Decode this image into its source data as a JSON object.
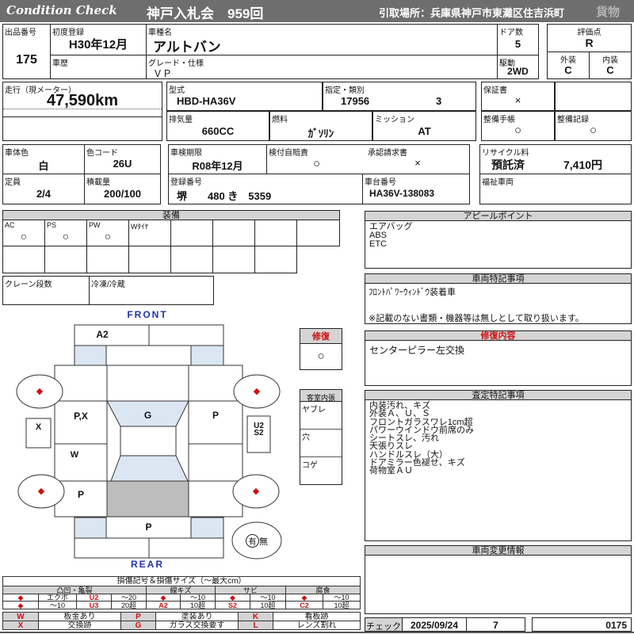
{
  "colors": {
    "accent_red": "#cc1111",
    "top_bar": "#6e6e6e",
    "section_bar": "#d4d4d4",
    "glass_blue": "#dbe6f2",
    "cargo_gray": "#bdbdbd",
    "label_blue": "#2233aa"
  },
  "header": {
    "brand": "Condition Check",
    "auction": "神戸入札会　959回",
    "pickup": "引取場所：兵庫県神戸市東灘区住吉浜町",
    "cargo": "貨物"
  },
  "info": {
    "lot_label": "出品番号",
    "lot": "175",
    "first_reg_label": "初度登録",
    "first_reg": "H30年12月",
    "history_label": "車歴",
    "history": "",
    "model_name_label": "車種名",
    "model_name": "アルトバン",
    "grade_label": "グレード・仕様",
    "grade": "ＶＰ",
    "doors_label": "ドア数",
    "doors": "5",
    "drive_label": "駆動",
    "drive": "2WD",
    "score_label": "評価点",
    "score": "R",
    "ext_label": "外装",
    "ext": "C",
    "int_label": "内装",
    "int": "C",
    "mileage_label": "走行（現メーター）",
    "mileage": "47,590km",
    "model_code_label": "型式",
    "model_code": "HBD-HA36V",
    "class_label": "指定・類別",
    "class1": "17956",
    "class2": "3",
    "warranty_label": "保証書",
    "warranty": "×",
    "displacement_label": "排気量",
    "displacement": "660CC",
    "fuel_label": "燃料",
    "fuel": "ｶﾞｿﾘﾝ",
    "mission_label": "ミッション",
    "mission": "AT",
    "maint_book_label": "整備手帳",
    "maint_book": "○",
    "maint_record_label": "整備記録",
    "maint_record": "○",
    "color_label": "車体色",
    "color": "白",
    "color_code_label": "色コード",
    "color_code": "26U",
    "inspection_label": "車検期限",
    "inspection": "R08年12月",
    "insurance_label": "検付自賠責",
    "insurance": "○",
    "approval_label": "承認請求書",
    "approval": "×",
    "recycle_label": "リサイクル料",
    "recycle_status": "預託済",
    "recycle_fee": "7,410円",
    "capacity_label": "定員",
    "capacity": "2/4",
    "load_label": "積載量",
    "load": "200/100",
    "reg_no_label": "登録番号",
    "reg_no": "堺　　480 き　5359",
    "chassis_label": "車台番号",
    "chassis": "HA36V-138083",
    "welfare_label": "福祉車両"
  },
  "equipment": {
    "title": "装備",
    "items": [
      "AC",
      "PS",
      "PW",
      "Wﾀｲﾔ"
    ],
    "marks": [
      "○",
      "○",
      "○",
      ""
    ],
    "crane_label": "クレーン段数",
    "fridge_label": "冷凍/冷蔵"
  },
  "diagram": {
    "front_label": "FRONT",
    "rear_label": "REAR",
    "hood": "A2",
    "left_front": "P,X",
    "roof": "G",
    "right_front": "P",
    "left_box": "X",
    "right_box_line1": "U2",
    "right_box_line2": "S2",
    "left_mid": "W",
    "left_rear": "P",
    "rear_center": "P",
    "wheel_mark": "◆",
    "spare_yes": "有",
    "spare_no": "無",
    "repair_label": "修復",
    "repair_mark": "○",
    "interior_label": "客室内張",
    "interior_items": [
      "ヤブレ",
      "穴",
      "コゲ"
    ]
  },
  "appeal": {
    "title": "アピールポイント",
    "lines": [
      "エアバッグ",
      "ABS",
      "ETC"
    ]
  },
  "vehicle_notes": {
    "title": "車両特記事項",
    "lines": [
      "ﾌﾛﾝﾄﾊﾟﾜｰｳｨﾝﾄﾞｳ装着車"
    ],
    "footer": "※記載のない書類・機器等は無しとして取り扱います。"
  },
  "repair_details": {
    "title": "修復内容",
    "lines": [
      "センターピラー左交換"
    ]
  },
  "assessment": {
    "title": "査定特記事項",
    "lines": [
      "内装汚れ、キズ",
      "外装Ａ、Ｕ、Ｓ",
      "フロントガラスワレ1cm超",
      "パワーウインドウ前席のみ",
      "シートスレ、汚れ",
      "天張りスレ",
      "ハンドルスレ（大）",
      "ドアミラー色褪せ、キズ",
      "荷物室ＡＵ"
    ]
  },
  "change_info": {
    "title": "車両変更情報"
  },
  "check": {
    "label": "チェック",
    "date": "2025/09/24",
    "num": "7",
    "code": "0175"
  },
  "legend": {
    "title": "損傷記号＆損傷サイズ（～最大cm）",
    "groups": [
      {
        "header": "凸凹・亀裂",
        "rows": [
          [
            "◆",
            "エクボ",
            "U2",
            "～20"
          ],
          [
            "◆",
            "～10",
            "U3",
            "20超"
          ]
        ]
      },
      {
        "header": "線キズ",
        "rows": [
          [
            "◆",
            "～10"
          ],
          [
            "A2",
            "10超"
          ]
        ]
      },
      {
        "header": "サビ",
        "rows": [
          [
            "◆",
            "～10"
          ],
          [
            "S2",
            "10超"
          ]
        ]
      },
      {
        "header": "腐食",
        "rows": [
          [
            "◆",
            "～10"
          ],
          [
            "C2",
            "10超"
          ]
        ]
      }
    ],
    "symbols": [
      {
        "code": "W",
        "desc": "板金あり"
      },
      {
        "code": "P",
        "desc": "塗装あり"
      },
      {
        "code": "K",
        "desc": "看板跡"
      },
      {
        "code": "X",
        "desc": "交換跡"
      },
      {
        "code": "G",
        "desc": "ガラス交換要す"
      },
      {
        "code": "L",
        "desc": "レンズ割れ"
      }
    ]
  }
}
